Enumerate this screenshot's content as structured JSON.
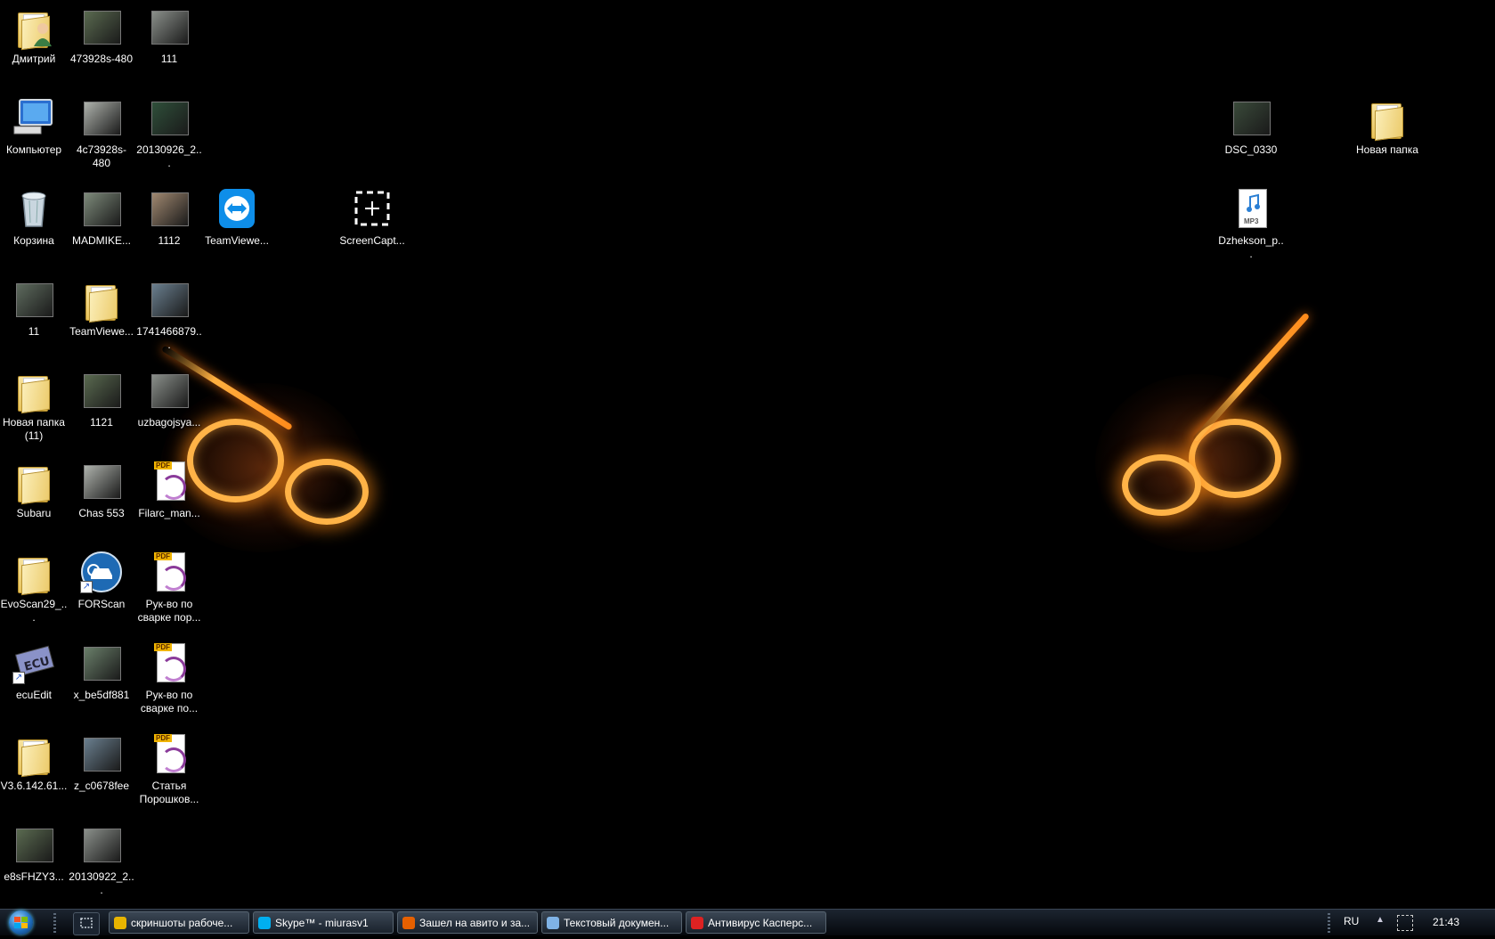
{
  "desktop": {
    "icons": [
      {
        "label": "Дмитрий",
        "kind": "user-folder"
      },
      {
        "label": "473928s-480",
        "kind": "image"
      },
      {
        "label": "111",
        "kind": "image"
      },
      {
        "label": "Компьютер",
        "kind": "computer"
      },
      {
        "label": "4c73928s-480",
        "kind": "image"
      },
      {
        "label": "20130926_2...",
        "kind": "image"
      },
      {
        "label": "Корзина",
        "kind": "recycle-bin"
      },
      {
        "label": "MADMIKE...",
        "kind": "image"
      },
      {
        "label": "1112",
        "kind": "image"
      },
      {
        "label": "TeamViewe...",
        "kind": "teamviewer"
      },
      {
        "label": "ScreenCapt...",
        "kind": "screencapture"
      },
      {
        "label": "11",
        "kind": "image"
      },
      {
        "label": "TeamViewe...",
        "kind": "folder"
      },
      {
        "label": "1741466879...",
        "kind": "image"
      },
      {
        "label": "Новая папка (11)",
        "kind": "folder"
      },
      {
        "label": "1121",
        "kind": "image"
      },
      {
        "label": "uzbagojsya...",
        "kind": "image"
      },
      {
        "label": "Subaru",
        "kind": "folder"
      },
      {
        "label": "Chas 553",
        "kind": "image"
      },
      {
        "label": "Filarc_man...",
        "kind": "pdf"
      },
      {
        "label": "EvoScan29_...",
        "kind": "folder"
      },
      {
        "label": "FORScan",
        "kind": "forscan"
      },
      {
        "label": "Рук-во по сварке пор...",
        "kind": "pdf"
      },
      {
        "label": "ecuEdit",
        "kind": "ecuedit"
      },
      {
        "label": "x_be5df881",
        "kind": "image"
      },
      {
        "label": "Рук-во по сварке по...",
        "kind": "pdf"
      },
      {
        "label": "V3.6.142.61...",
        "kind": "folder"
      },
      {
        "label": "z_c0678fee",
        "kind": "image"
      },
      {
        "label": "Статья Порошков...",
        "kind": "pdf"
      },
      {
        "label": "e8sFHZY3...",
        "kind": "image"
      },
      {
        "label": "20130922_2...",
        "kind": "image"
      },
      {
        "label": "DSC_0330",
        "kind": "image"
      },
      {
        "label": "Новая папка",
        "kind": "folder"
      },
      {
        "label": "Dzhekson_p...",
        "kind": "mp3"
      }
    ],
    "badges": {
      "pdf": "PDF",
      "mp3": "MP3",
      "ecu": "ECU"
    }
  },
  "taskbar": {
    "tasks": [
      {
        "label": "скриншоты рабоче...",
        "icon": "chrome-icon",
        "color": "#e8b400"
      },
      {
        "label": "Skype™ - miurasv1",
        "icon": "skype-icon",
        "color": "#00aff0"
      },
      {
        "label": "Зашел на авито и за...",
        "icon": "firefox-icon",
        "color": "#e66000"
      },
      {
        "label": "Текстовый докумен...",
        "icon": "notepad-icon",
        "color": "#7fb2e5"
      },
      {
        "label": "Антивирус Касперс...",
        "icon": "kaspersky-icon",
        "color": "#d22"
      }
    ],
    "tray": {
      "language": "RU",
      "clock": "21:43"
    }
  }
}
